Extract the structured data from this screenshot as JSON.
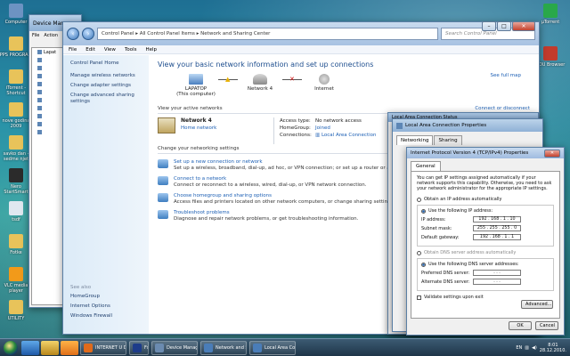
{
  "desktop": {
    "icons": [
      {
        "label": "Computer",
        "color": "#6d93c2"
      },
      {
        "label": "PPS PROGRA...",
        "color": "#e8c35a"
      },
      {
        "label": "iTorrent - Shortcut",
        "color": "#e8c35a"
      },
      {
        "label": "nove godina 2009",
        "color": "#e8c35a"
      },
      {
        "label": "savko dan - sedme njet",
        "color": "#e8c35a"
      },
      {
        "label": "Nero StartSmart",
        "color": "#2b2b2b"
      },
      {
        "label": "tsdf",
        "color": "#e0e8f0"
      },
      {
        "label": "Fotke",
        "color": "#e8c35a"
      },
      {
        "label": "VLC media player",
        "color": "#f29a1a"
      },
      {
        "label": "UTILITY",
        "color": "#e8c35a"
      }
    ],
    "right_icons": [
      {
        "label": "µTorrent",
        "color": "#29a84a"
      },
      {
        "label": "EDU Browser",
        "color": "#c23b2c"
      }
    ]
  },
  "device_manager": {
    "title": "Device Man",
    "menu": [
      "File",
      "Action"
    ],
    "tree_root": "Lapat",
    "tree_items_count_label": ""
  },
  "nsc": {
    "address": [
      "Control Panel",
      "All Control Panel Items",
      "Network and Sharing Center"
    ],
    "search_placeholder": "Search Control Panel",
    "menu": [
      "File",
      "Edit",
      "View",
      "Tools",
      "Help"
    ],
    "left": {
      "title": "Control Panel Home",
      "links": [
        "Manage wireless networks",
        "Change adapter settings",
        "Change advanced sharing settings"
      ],
      "see_also_title": "See also",
      "see_also": [
        "HomeGroup",
        "Internet Options",
        "Windows Firewall"
      ]
    },
    "heading": "View your basic network information and set up connections",
    "full_map": "See full map",
    "map": [
      {
        "name": "LAPATOP",
        "sub": "(This computer)"
      },
      {
        "name": "Network  4",
        "sub": ""
      },
      {
        "name": "Internet",
        "sub": ""
      }
    ],
    "active_label": "View your active networks",
    "connect_disconnect": "Connect or disconnect",
    "active": {
      "name": "Network  4",
      "type": "Home network",
      "props": [
        {
          "k": "Access type:",
          "v": "No network access",
          "link": false
        },
        {
          "k": "HomeGroup:",
          "v": "Joined",
          "link": true
        },
        {
          "k": "Connections:",
          "v": "Local Area Connection",
          "link": true
        }
      ]
    },
    "change_label": "Change your networking settings",
    "tasks": [
      {
        "title": "Set up a new connection or network",
        "desc": "Set up a wireless, broadband, dial-up, ad hoc, or VPN connection; or set up a router or access point."
      },
      {
        "title": "Connect to a network",
        "desc": "Connect or reconnect to a wireless, wired, dial-up, or VPN network connection."
      },
      {
        "title": "Choose homegroup and sharing options",
        "desc": "Access files and printers located on other network computers, or change sharing settings."
      },
      {
        "title": "Troubleshoot problems",
        "desc": "Diagnose and repair network problems, or get troubleshooting information."
      }
    ]
  },
  "lac_status": {
    "title": "Local Area Connection Status"
  },
  "lac_props": {
    "title": "Local Area Connection Properties",
    "tabs": [
      "Networking",
      "Sharing"
    ]
  },
  "ipv4": {
    "title": "Internet Protocol Version 4 (TCP/IPv4) Properties",
    "tab": "General",
    "desc": "You can get IP settings assigned automatically if your network supports this capability. Otherwise, you need to ask your network administrator for the appropriate IP settings.",
    "auto_ip": "Obtain an IP address automatically",
    "use_ip": "Use the following IP address:",
    "ip_label": "IP address:",
    "ip": "192 . 168 .  1  . 10",
    "mask_label": "Subnet mask:",
    "mask": "255 . 255 . 255 .  0",
    "gw_label": "Default gateway:",
    "gw": "192 . 168 .  1  .  1",
    "auto_dns": "Obtain DNS server address automatically",
    "use_dns": "Use the following DNS server addresses:",
    "pdns_label": "Preferred DNS server:",
    "adns_label": "Alternate DNS server:",
    "dns_empty": ".    .    .",
    "validate": "Validate settings upon exit",
    "advanced": "Advanced...",
    "ok": "OK",
    "cancel": "Cancel"
  },
  "taskbar": {
    "buttons": [
      {
        "label": "INTERNET U DUB...",
        "color": "#e06a1a"
      },
      {
        "label": "Fs",
        "color": "#1d3c8a"
      },
      {
        "label": "Device Manager",
        "color": "#6b8bb0"
      },
      {
        "label": "Network and Shar...",
        "color": "#4a7db8"
      },
      {
        "label": "Local Area Conne...",
        "color": "#4a7db8"
      }
    ],
    "lang": "EN",
    "time": "8:01",
    "date": "28.12.2010."
  }
}
